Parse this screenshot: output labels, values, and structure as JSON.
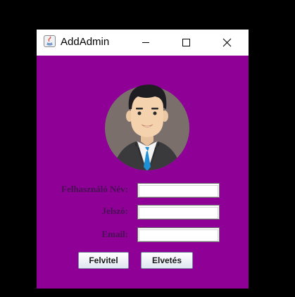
{
  "window": {
    "title": "AddAdmin",
    "colors": {
      "background": "#8e0096",
      "titlebar": "#ffffff"
    }
  },
  "titlebar_controls": {
    "minimize_icon": "minimize-icon",
    "maximize_icon": "maximize-icon",
    "close_icon": "close-icon"
  },
  "avatar": {
    "icon": "businessman-avatar"
  },
  "form": {
    "username_label": "Felhasználó Név:",
    "username_value": "",
    "password_label": "Jelszó:",
    "password_value": "",
    "email_label": "Email:",
    "email_value": ""
  },
  "buttons": {
    "submit_label": "Felvitel",
    "discard_label": "Elvetés"
  }
}
